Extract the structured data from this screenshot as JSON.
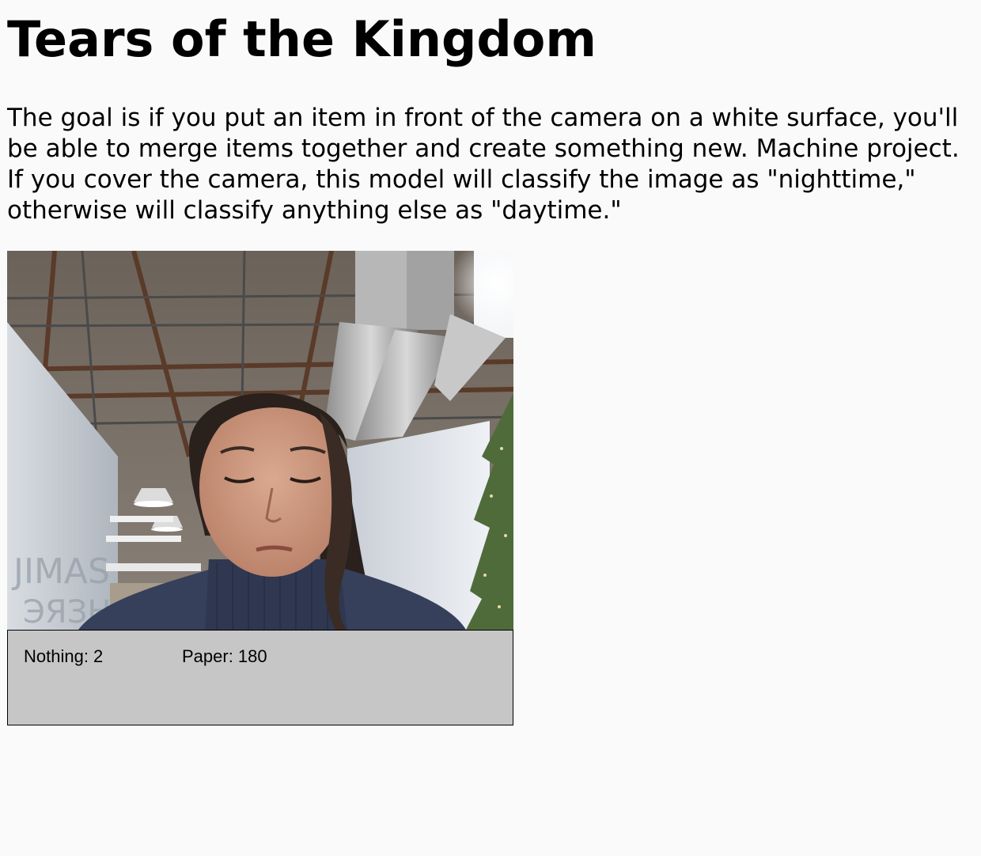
{
  "page": {
    "title": "Tears of the Kingdom",
    "description": "The goal is if you put an item in front of the camera on a white surface, you'll be able to merge items together and create something new. Machine project. If you cover the camera, this model will classify the image as \"nighttime,\" otherwise will classify anything else as \"daytime.\""
  },
  "camera": {
    "icon": "webcam-video-feed"
  },
  "classifier": {
    "labels": [
      {
        "text": "Nothing: 2"
      },
      {
        "text": "Paper: 180"
      }
    ]
  },
  "colors": {
    "page_background": "#fafafa",
    "panel_background": "#c6c6c6",
    "panel_border": "#000000"
  }
}
